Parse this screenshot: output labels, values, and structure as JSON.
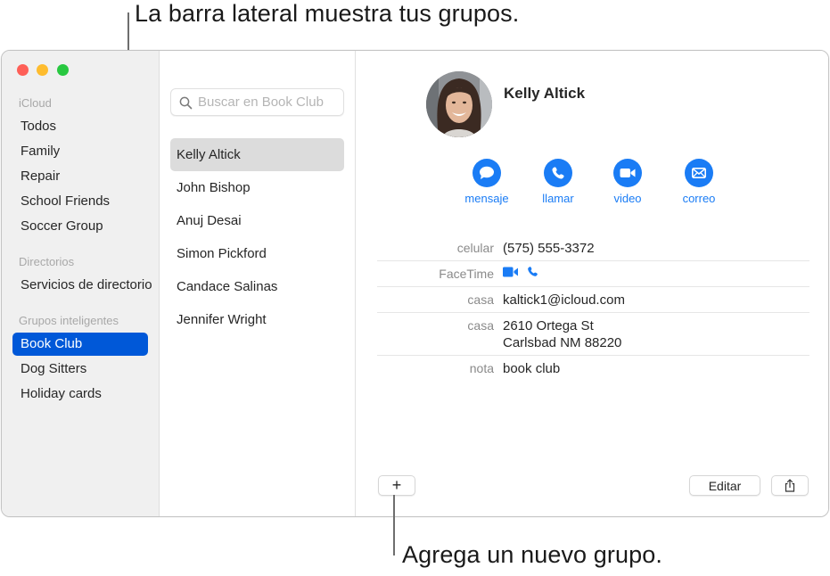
{
  "callouts": {
    "top": "La barra lateral muestra tus grupos.",
    "bottom": "Agrega un nuevo grupo."
  },
  "sidebar": {
    "sections": [
      {
        "title": "iCloud",
        "items": [
          "Todos",
          "Family",
          "Repair",
          "School Friends",
          "Soccer Group"
        ]
      },
      {
        "title": "Directorios",
        "items": [
          "Servicios de directorio"
        ]
      },
      {
        "title": "Grupos inteligentes",
        "items": [
          "Book Club",
          "Dog Sitters",
          "Holiday cards"
        ]
      }
    ],
    "selected": "Book Club"
  },
  "search": {
    "placeholder": "Buscar en Book Club",
    "value": ""
  },
  "contacts": {
    "items": [
      "Kelly Altick",
      "John Bishop",
      "Anuj Desai",
      "Simon Pickford",
      "Candace Salinas",
      "Jennifer Wright"
    ],
    "selected": "Kelly Altick"
  },
  "detail": {
    "name": "Kelly Altick",
    "actions": [
      {
        "label": "mensaje",
        "icon": "message-bubble-icon"
      },
      {
        "label": "llamar",
        "icon": "phone-icon"
      },
      {
        "label": "video",
        "icon": "video-camera-icon"
      },
      {
        "label": "correo",
        "icon": "envelope-icon"
      }
    ],
    "fields": [
      {
        "label": "celular",
        "value": "(575) 555-3372"
      },
      {
        "label": "FaceTime",
        "value": ""
      },
      {
        "label": "casa",
        "value": "kaltick1@icloud.com"
      },
      {
        "label": "casa",
        "value": "2610 Ortega St",
        "value2": "Carlsbad NM 88220"
      },
      {
        "label": "nota",
        "value": "book club"
      }
    ]
  },
  "toolbar": {
    "add_label": "+",
    "edit_label": "Editar",
    "share_icon": "share-icon"
  },
  "colors": {
    "accent": "#1a7cf5",
    "sidebar_selection": "#0058d8",
    "list_selection": "#dcdcdc",
    "traffic_red": "#fe5f57",
    "traffic_yellow": "#febc2e",
    "traffic_green": "#28c840"
  }
}
